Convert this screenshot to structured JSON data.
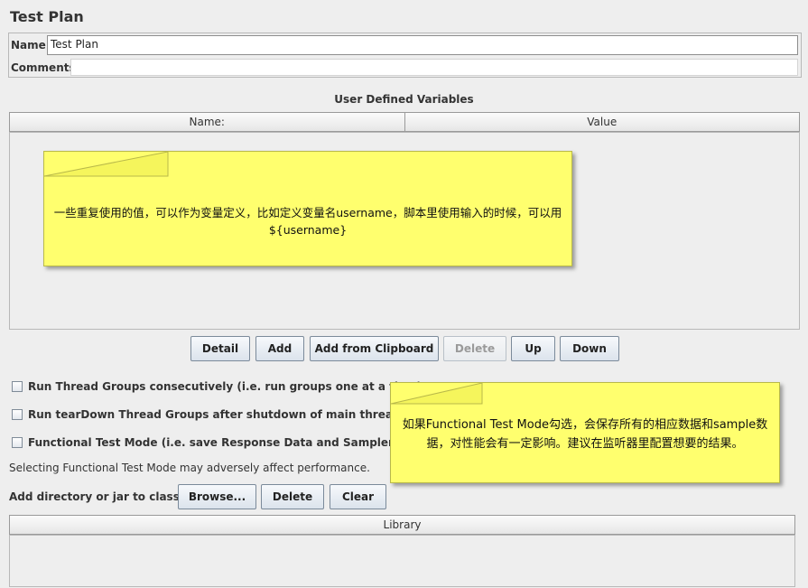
{
  "page": {
    "title": "Test Plan"
  },
  "fields": {
    "name_label": "Name:",
    "name_value": "Test Plan",
    "comments_label": "Comments:",
    "comments_value": ""
  },
  "variables": {
    "section_title": "User Defined Variables",
    "columns": [
      "Name:",
      "Value"
    ],
    "rows": [],
    "buttons": {
      "detail": "Detail",
      "add": "Add",
      "add_from_clipboard": "Add from Clipboard",
      "delete": "Delete",
      "up": "Up",
      "down": "Down"
    },
    "delete_enabled": false
  },
  "options": {
    "run_consecutively": {
      "label": "Run Thread Groups consecutively (i.e. run groups one at a time)",
      "checked": false
    },
    "run_teardown": {
      "label": "Run tearDown Thread Groups after shutdown of main threads",
      "checked": false
    },
    "functional_mode": {
      "label": "Functional Test Mode (i.e. save Response Data and Sampler Data)",
      "checked": false
    },
    "functional_warning": "Selecting Functional Test Mode may adversely affect performance."
  },
  "classpath": {
    "label": "Add directory or jar to classpath",
    "browse": "Browse...",
    "delete": "Delete",
    "clear": "Clear",
    "table_header": "Library"
  },
  "annotations": {
    "note1": "一些重复使用的值，可以作为变量定义，比如定义变量名username，脚本里使用输入的时候，可以用${username}",
    "note2": "如果Functional Test Mode勾选，会保存所有的相应数据和sample数据，对性能会有一定影响。建议在监听器里配置想要的结果。"
  },
  "colors": {
    "background": "#eeeeee",
    "note_fill": "#ffff6e",
    "button_top": "#f7f9fc",
    "button_bottom": "#dbe3ec"
  }
}
